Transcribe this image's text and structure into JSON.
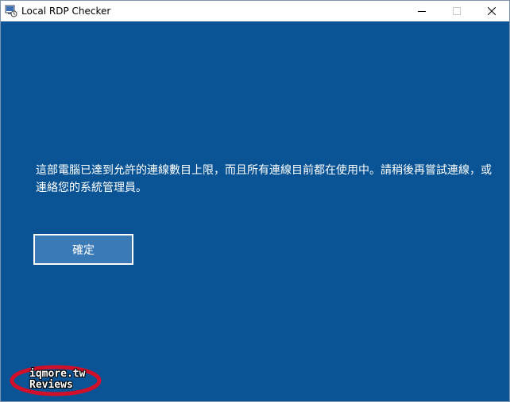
{
  "window": {
    "title": "Local RDP Checker"
  },
  "dialog": {
    "message": "這部電腦已達到允許的連線數目上限，而且所有連線目前都在使用中。請稍後再嘗試連線，或連絡您的系統管理員。",
    "ok_label": "確定"
  },
  "watermark": {
    "line1": "iqmore.tw",
    "line2": "Reviews"
  },
  "colors": {
    "background": "#0a5495",
    "button": "#3a7ab6",
    "watermark_ring": "#d0102a"
  },
  "icons": {
    "app": "rdp-app-icon",
    "minimize": "minimize-icon",
    "maximize": "maximize-icon",
    "close": "close-icon"
  }
}
